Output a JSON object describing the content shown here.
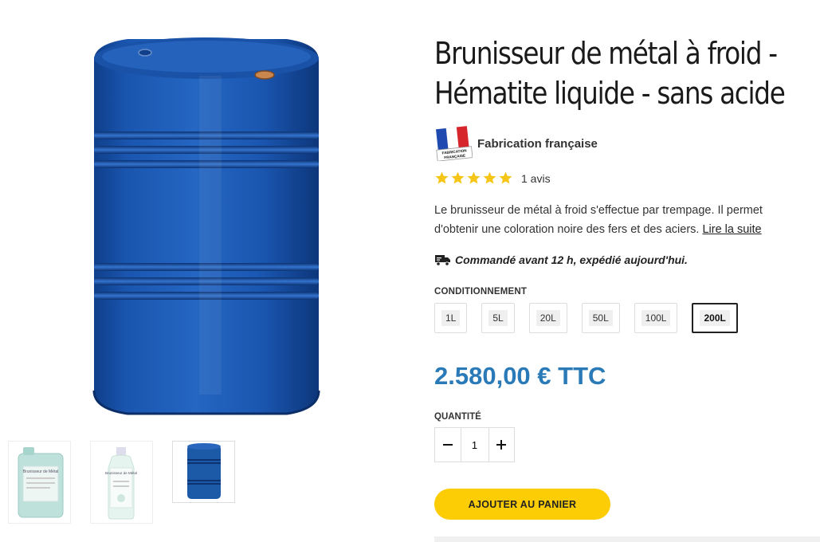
{
  "product": {
    "title": "Brunisseur de métal à froid - Hématite liquide - sans acide",
    "made_in_label": "Fabrication française",
    "flag_text": "FABRICATION FRANÇAISE",
    "rating": {
      "stars": 5,
      "max": 5,
      "count_label": "1 avis"
    },
    "description": "Le brunisseur de métal à froid s'effectue par trempage. Il permet d'obtenir une coloration noire des fers et des aciers.",
    "read_more": "Lire la suite",
    "shipping": "Commandé avant 12 h, expédié aujourd'hui.",
    "conditioning_label": "CONDITIONNEMENT",
    "variants": [
      {
        "label": "1L",
        "selected": false
      },
      {
        "label": "5L",
        "selected": false
      },
      {
        "label": "20L",
        "selected": false
      },
      {
        "label": "50L",
        "selected": false
      },
      {
        "label": "100L",
        "selected": false
      },
      {
        "label": "200L",
        "selected": true
      }
    ],
    "price": "2.580,00 € TTC",
    "quantity_label": "QUANTITÉ",
    "quantity": "1",
    "add_to_cart": "AJOUTER AU PANIER"
  },
  "gallery": {
    "main": "blue-drum-image",
    "thumbnails": [
      {
        "name": "jerrican-thumbnail",
        "label": "Brunisseur de Métal"
      },
      {
        "name": "bottle-thumbnail",
        "label": "Brunisseur de Métal"
      },
      {
        "name": "drum-thumbnail",
        "label": ""
      }
    ]
  },
  "colors": {
    "price": "#2a7ab8",
    "cart_button": "#fccd05",
    "star": "#f5c518",
    "drum": "#1c5aa8"
  }
}
